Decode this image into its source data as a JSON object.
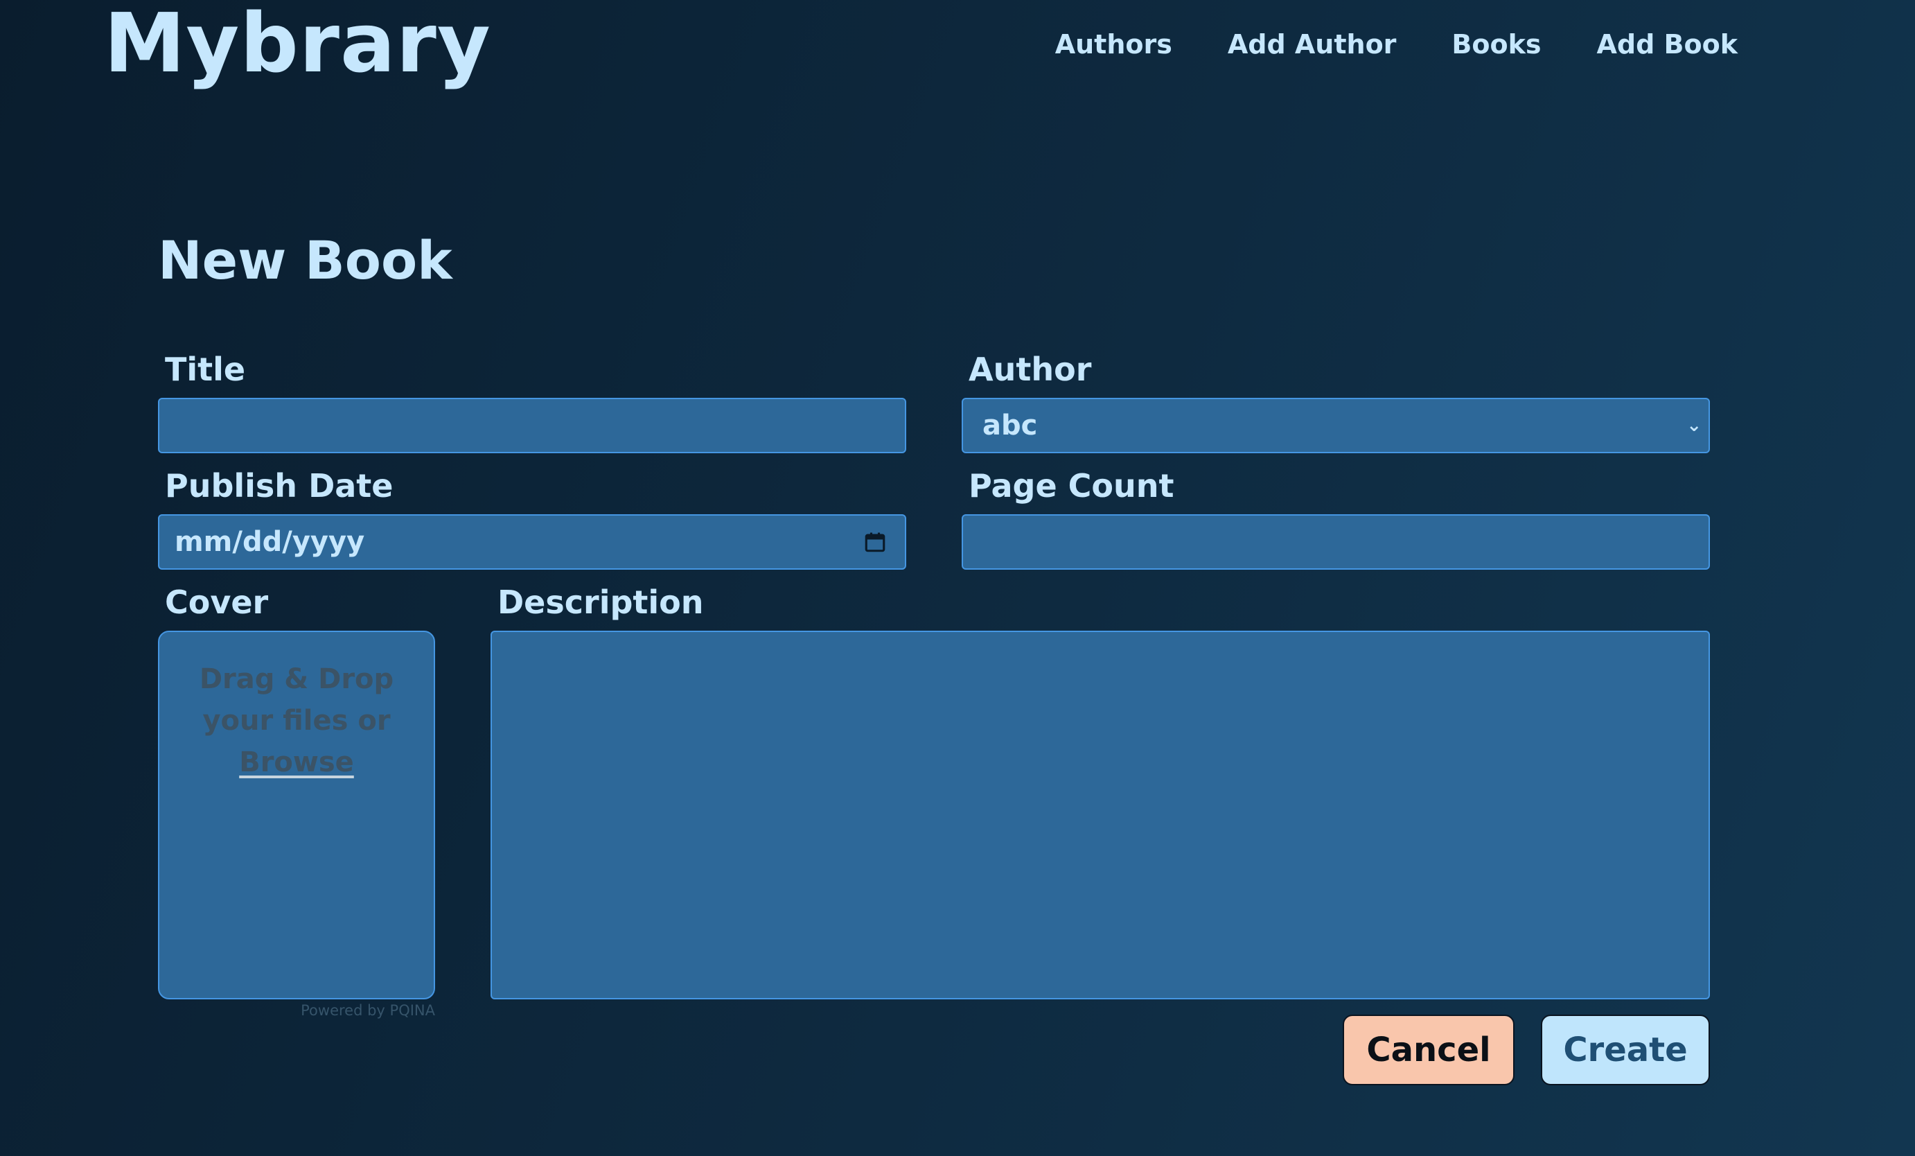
{
  "header": {
    "logo": "Mybrary",
    "nav": [
      {
        "label": "Authors"
      },
      {
        "label": "Add Author"
      },
      {
        "label": "Books"
      },
      {
        "label": "Add Book"
      }
    ]
  },
  "form": {
    "title": "New Book",
    "title_field": {
      "label": "Title",
      "value": ""
    },
    "author_field": {
      "label": "Author",
      "selected": "abc"
    },
    "publish_date_field": {
      "label": "Publish Date",
      "placeholder": "mm/dd/yyyy"
    },
    "page_count_field": {
      "label": "Page Count",
      "value": ""
    },
    "cover_field": {
      "label": "Cover",
      "drop_text": "Drag & Drop your files or",
      "browse_label": "Browse",
      "powered_by": "Powered by PQINA"
    },
    "description_field": {
      "label": "Description",
      "value": ""
    },
    "cancel_label": "Cancel",
    "create_label": "Create"
  },
  "colors": {
    "background": "#0e2a40",
    "field_background": "#2d6899",
    "field_border": "#4596e2",
    "text_light": "#c6e7fd",
    "cancel_button": "#f9c6ac",
    "create_button": "#bfe5fc"
  },
  "icons": {
    "calendar": "calendar-icon",
    "chevron": "chevron-down-icon"
  }
}
